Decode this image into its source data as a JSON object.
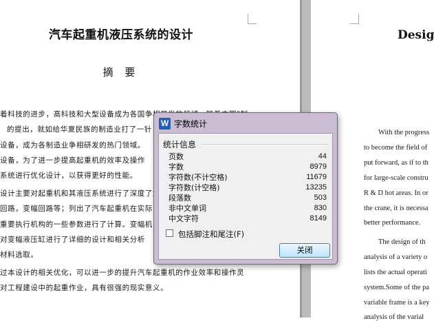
{
  "document": {
    "cn_title": "汽车起重机液压系统的设计",
    "abstract_heading": "摘 要",
    "cn_lines": [
      "着科技的进步，高科技和大型设备成为各国争相开发的领域，随着中国\"制",
      "的提出，就如给华夏民族的制造业打了一针",
      "设备，成为各制造业争相研发的热门领域。",
      "设备，为了进一步提高起重机的效率及操作",
      "系统进行优化设计，以获得更好的性能。",
      "设计主要对起重机和其液压系统进行了深度了解",
      "回路，变幅回路等；列出了汽车起重机在实际",
      "重要执行机构的一些参数进行了计算。变幅机",
      "对变幅液压缸进行了详细的设计和相关分析",
      "材料选取。",
      "过本设计的相关优化，可以进一步的提升汽车起重机的作业效率和操作灵",
      "对工程建设中的起重作业，具有很强的现实意义。"
    ],
    "en_title": "Design",
    "en_lines": [
      "With the progress",
      "to become the field of",
      "put forward, as if to th",
      "for large-scale constru",
      "R & D hot areas. In or",
      "the crane, it is necessa",
      "better performance.",
      "The design of th",
      "analysis of a variety o",
      "lists the actual operati",
      "system.Some of the pa",
      "variable frame is a key",
      "analysis of the varial"
    ]
  },
  "dialog": {
    "title": "字数统计",
    "section_label": "统计信息",
    "stats": [
      {
        "label": "页数",
        "value": "44"
      },
      {
        "label": "字数",
        "value": "8979"
      },
      {
        "label": "字符数(不计空格)",
        "value": "11679"
      },
      {
        "label": "字符数(计空格)",
        "value": "13235"
      },
      {
        "label": "段落数",
        "value": "503"
      },
      {
        "label": "非中文单词",
        "value": "830"
      },
      {
        "label": "中文字符",
        "value": "8149"
      }
    ],
    "checkbox_label": "包括脚注和尾注(F)",
    "checkbox_checked": false,
    "close_button_label": "关闭",
    "app_icon": "wps-writer-icon",
    "app_icon_glyph": "W"
  }
}
